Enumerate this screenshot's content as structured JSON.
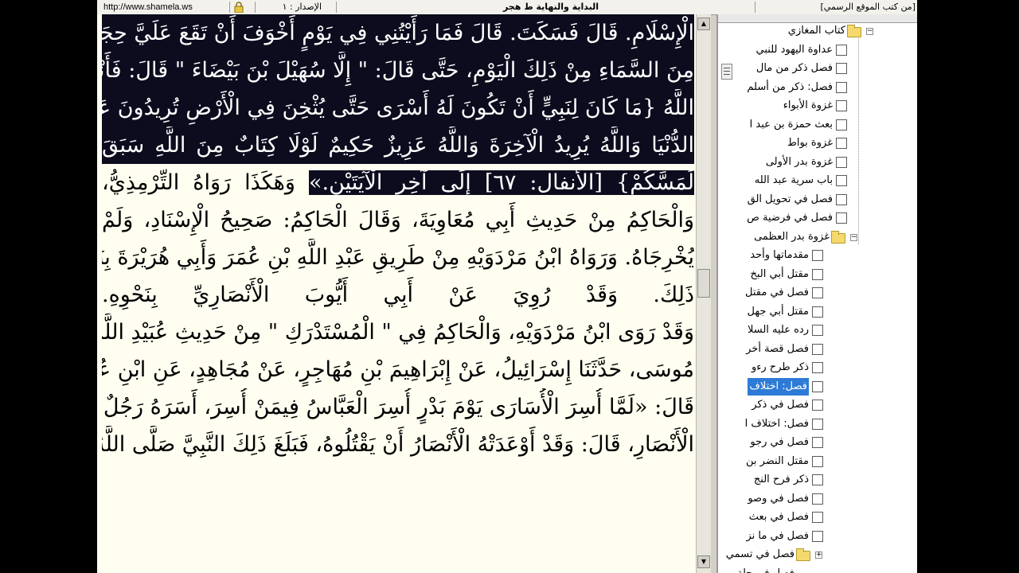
{
  "status_bar": {
    "url": "http://www.shamela.ws",
    "edition": "الإصدار : ١",
    "book_title": "البداية والنهاية ط هجر",
    "site_link": "[من كتب الموقع الرسمي]"
  },
  "reader": {
    "lines": [
      {
        "hl": "الْإِسْلَامِ. قَالَ فَسَكَتَ. قَالَ فَمَا رَأَيْتُنِي فِي يَوْمٍ أَخْوَفَ أَنْ تَقَعَ عَلَيَّ حِجَارَةٌ",
        "rest": ""
      },
      {
        "hl": "مِنَ السَّمَاءِ مِنْ ذَلِكَ الْيَوْمِ، حَتَّى قَالَ: \" إِلَّا سُهَيْلَ بْنَ بَيْضَاءَ \" قَالَ: فَأَنْزَلَ",
        "rest": ""
      },
      {
        "hl": "اللَّهُ {مَا كَانَ لِنَبِيٍّ أَنْ تَكُونَ لَهُ أَسْرَى حَتَّى يُثْخِنَ فِي الْأَرْضِ تُرِيدُونَ عَرَضَ",
        "rest": ""
      },
      {
        "hl": "الدُّنْيَا وَاللَّهُ يُرِيدُ الْآخِرَةَ وَاللَّهُ عَزِيزٌ حَكِيمٌ لَوْلَا كِتَابٌ مِنَ اللَّهِ سَبَقَ",
        "rest": ""
      },
      {
        "hl": "لَمَسَّكُمْ} [الأنفال: ٦٧] إِلَى آخِرِ الْآيَتَيْنِ.»",
        "rest": " وَهَكَذَا رَوَاهُ التِّرْمِذِيُّ،"
      },
      {
        "hl": "",
        "rest": "وَالْحَاكِمُ مِنْ حَدِيثِ أَبِي مُعَاوِيَةَ، وَقَالَ الْحَاكِمُ: صَحِيحُ الْإِسْنَادِ، وَلَمْ"
      },
      {
        "hl": "",
        "rest": "يُخْرِجَاهُ. وَرَوَاهُ ابْنُ مَرْدَوَيْهِ مِنْ طَرِيقِ عَبْدِ اللَّهِ بْنِ عُمَرَ وَأَبِي هُرَيْرَةَ بِنَحْوِ"
      },
      {
        "hl": "",
        "rest": "ذَلِكَ. وَقَدْ رُوِيَ عَنْ أَبِي أَيُّوبَ الْأَنْصَارِيِّ بِنَحْوِهِ."
      },
      {
        "hl": "",
        "rest": "وَقَدْ رَوَى ابْنُ مَرْدَوَيْهِ، وَالْحَاكِمُ فِي \" الْمُسْتَدْرَكِ \" مِنْ حَدِيثِ عُبَيْدِ اللَّهِ بْنِ"
      },
      {
        "hl": "",
        "rest": "مُوسَى، حَدَّثَنَا إِسْرَائِيلُ، عَنْ إِبْرَاهِيمَ بْنِ مُهَاجِرٍ، عَنْ مُجَاهِدٍ، عَنِ ابْنِ عُمَرَ،"
      },
      {
        "hl": "",
        "rest": "قَالَ: «لَمَّا أُسِرَ الْأُسَارَى يَوْمَ بَدْرٍ أُسِرَ الْعَبَّاسُ فِيمَنْ أُسِرَ، أَسَرَهُ رَجُلٌ مِنَ"
      },
      {
        "hl": "",
        "rest": "الْأَنْصَارِ، قَالَ: وَقَدْ أَوْعَدَتْهُ الْأَنْصَارُ أَنْ يَقْتُلُوهُ، فَبَلَغَ ذَلِكَ النَّبِيَّ صَلَّى اللَّهُ"
      }
    ]
  },
  "tree": {
    "root_label": "كتاب المغازي",
    "children": [
      "عداوة اليهود للنبي",
      "فصل ذكر من مال",
      "فصل: ذكر من أسلم",
      "غزوة الأبواء",
      "بعث حمزة بن عبد ا",
      "غزوة بواط",
      "غزوة بدر الأولى",
      "باب سرية عبد الله",
      "فصل في تحويل الق",
      "فصل في فرضية ص"
    ],
    "sub_folder_label": "غزوة بدر العظمى",
    "sub_children": [
      "مقدماتها وأحد",
      "مقتل أبي البخ",
      "فصل في مقتل",
      "مقتل أبي جهل",
      "رده عليه السلا",
      "فصل قصة أخر",
      "ذكر طرح رءو",
      "فصل: اختلاف",
      "فصل في ذكر",
      "فصل: اختلاف ا",
      "فصل في رجو",
      "مقتل النضر بن",
      "ذكر فرح النج",
      "فصل في وصو",
      "فصل في بعث",
      "فصل في ما نز"
    ],
    "selected_index": 7,
    "last_folder_label": "فصل في تسمي",
    "last_item": "فصل في حلة"
  }
}
